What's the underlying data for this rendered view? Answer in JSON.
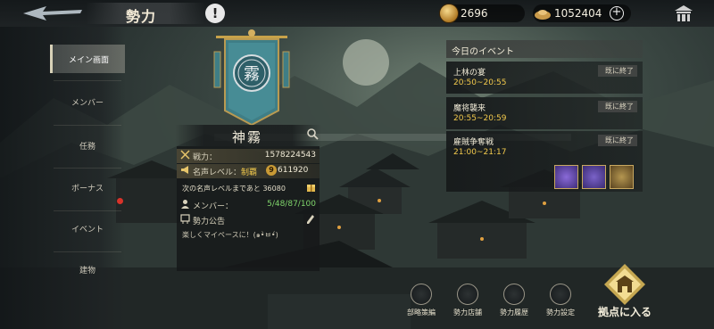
{
  "header": {
    "title": "勢力",
    "alert_label": "!",
    "gold": "2696",
    "silver": "1052404",
    "plus_label": "+"
  },
  "nav": {
    "items": [
      {
        "label": "メイン画面"
      },
      {
        "label": "メンバー"
      },
      {
        "label": "任務"
      },
      {
        "label": "ボーナス"
      },
      {
        "label": "イベント"
      },
      {
        "label": "建物"
      }
    ]
  },
  "guild": {
    "name": "神霧",
    "emblem_char": "霧",
    "power_label": "戦力：",
    "power_value": "1578224543",
    "fame_label": "名声レベル：",
    "fame_tier": "制覇",
    "fame_level": "9",
    "fame_value": "611920",
    "next_fame_text": "次の名声レベルまであと 36080",
    "members_label": "メンバー：",
    "members_value": "5/48/87/100",
    "announce_label": "勢力公告",
    "announce_text": "楽しくマイペースに！(๑•̀ㅂ•́)"
  },
  "events": {
    "heading": "今日のイベント",
    "items": [
      {
        "name": "上林の宴",
        "time": "20:50~20:55",
        "status": "既に終了"
      },
      {
        "name": "魔将襲来",
        "time": "20:55~20:59",
        "status": "既に終了"
      },
      {
        "name": "雇賊争奪戦",
        "time": "21:00~21:17",
        "status": "既に終了"
      }
    ]
  },
  "actions": {
    "items": [
      {
        "label": "部略策編",
        "icon": "book-icon"
      },
      {
        "label": "勢力店舗",
        "icon": "shop-icon"
      },
      {
        "label": "勢力履歴",
        "icon": "scroll-icon"
      },
      {
        "label": "勢力設定",
        "icon": "settings-icon"
      }
    ],
    "enter_label": "拠点に入る"
  },
  "colors": {
    "gold_text": "#f2c94c",
    "member_green": "#7fd46b",
    "notif_red": "#d8332a"
  }
}
